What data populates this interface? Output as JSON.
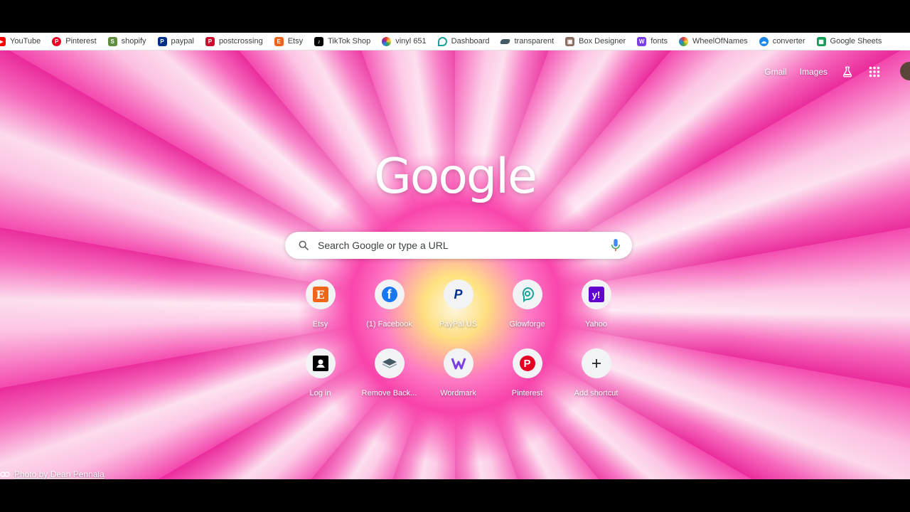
{
  "bookmarks": [
    {
      "label": "YouTube",
      "icon": "youtube-icon",
      "color": "#ff0000"
    },
    {
      "label": "Pinterest",
      "icon": "pinterest-icon",
      "color": "#e60023"
    },
    {
      "label": "shopify",
      "icon": "shopify-icon",
      "color": "#5e8e3e"
    },
    {
      "label": "paypal",
      "icon": "paypal-icon",
      "color": "#003087"
    },
    {
      "label": "postcrossing",
      "icon": "postcrossing-icon",
      "color": "#c8102e"
    },
    {
      "label": "Etsy",
      "icon": "etsy-icon",
      "color": "#f1641e"
    },
    {
      "label": "TikTok Shop",
      "icon": "tiktok-icon",
      "color": "#000000"
    },
    {
      "label": "vinyl 651",
      "icon": "vinyl-icon",
      "color": "#7b3fa0"
    },
    {
      "label": "Dashboard",
      "icon": "dashboard-icon",
      "color": "#1aa39a"
    },
    {
      "label": "transparent",
      "icon": "layers-icon",
      "color": "#455a64"
    },
    {
      "label": "Box Designer",
      "icon": "box-designer-icon",
      "color": "#8d6e63"
    },
    {
      "label": "fonts",
      "icon": "fonts-icon",
      "color": "#7b3fe4"
    },
    {
      "label": "WheelOfNames",
      "icon": "wheel-icon",
      "color": "#e91e63"
    },
    {
      "label": "converter",
      "icon": "cloud-icon",
      "color": "#1e88e5"
    },
    {
      "label": "Google Sheets",
      "icon": "sheets-icon",
      "color": "#0f9d58"
    }
  ],
  "header": {
    "gmail": "Gmail",
    "images": "Images"
  },
  "logo": "Google",
  "search": {
    "placeholder": "Search Google or type a URL"
  },
  "shortcuts": [
    {
      "label": "Etsy",
      "icon": "etsy-icon",
      "color": "#f1641e"
    },
    {
      "label": "(1) Facebook",
      "icon": "facebook-icon",
      "color": "#1877f2"
    },
    {
      "label": "PayPal US",
      "icon": "paypal-icon",
      "color": "#003087"
    },
    {
      "label": "Glowforge",
      "icon": "glowforge-icon",
      "color": "#1aa39a"
    },
    {
      "label": "Yahoo",
      "icon": "yahoo-icon",
      "color": "#6001d2"
    },
    {
      "label": "Log in",
      "icon": "login-icon",
      "color": "#000000"
    },
    {
      "label": "Remove Back...",
      "icon": "layers-icon",
      "color": "#455a64"
    },
    {
      "label": "Wordmark",
      "icon": "wordmark-icon",
      "color": "#7b3fe4"
    },
    {
      "label": "Pinterest",
      "icon": "pinterest-icon",
      "color": "#e60023"
    },
    {
      "label": "Add shortcut",
      "icon": "plus-icon",
      "color": "#202124"
    }
  ],
  "attribution": "Photo by Dean Pennala"
}
